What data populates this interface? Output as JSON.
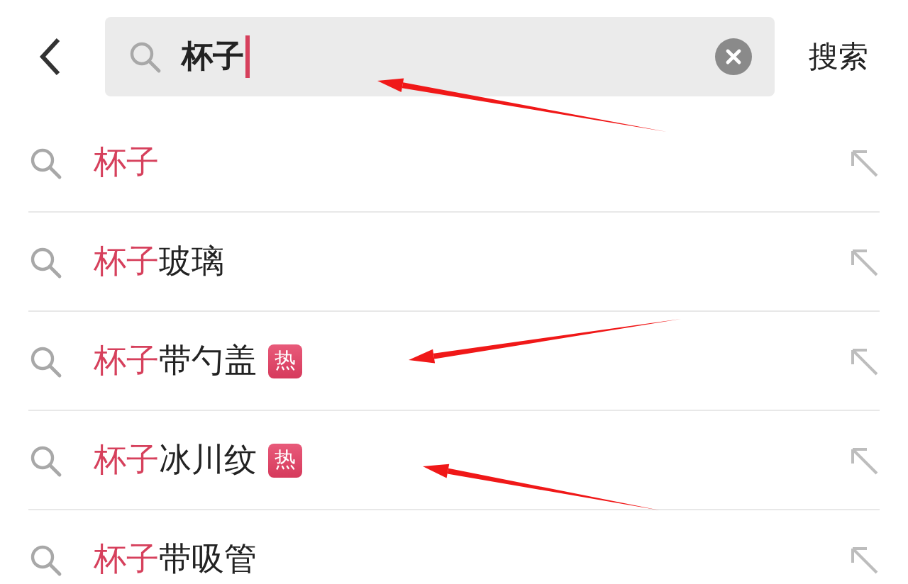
{
  "header": {
    "query": "杯子",
    "submit": "搜索"
  },
  "suggestions": [
    {
      "match": "杯子"
    },
    {
      "match": "杯子",
      "rest": "玻璃"
    },
    {
      "match": "杯子",
      "rest": "带勺盖",
      "badge": "热"
    },
    {
      "match": "杯子",
      "rest": "冰川纹",
      "badge": "热"
    },
    {
      "match": "杯子",
      "rest": "带吸管"
    }
  ]
}
